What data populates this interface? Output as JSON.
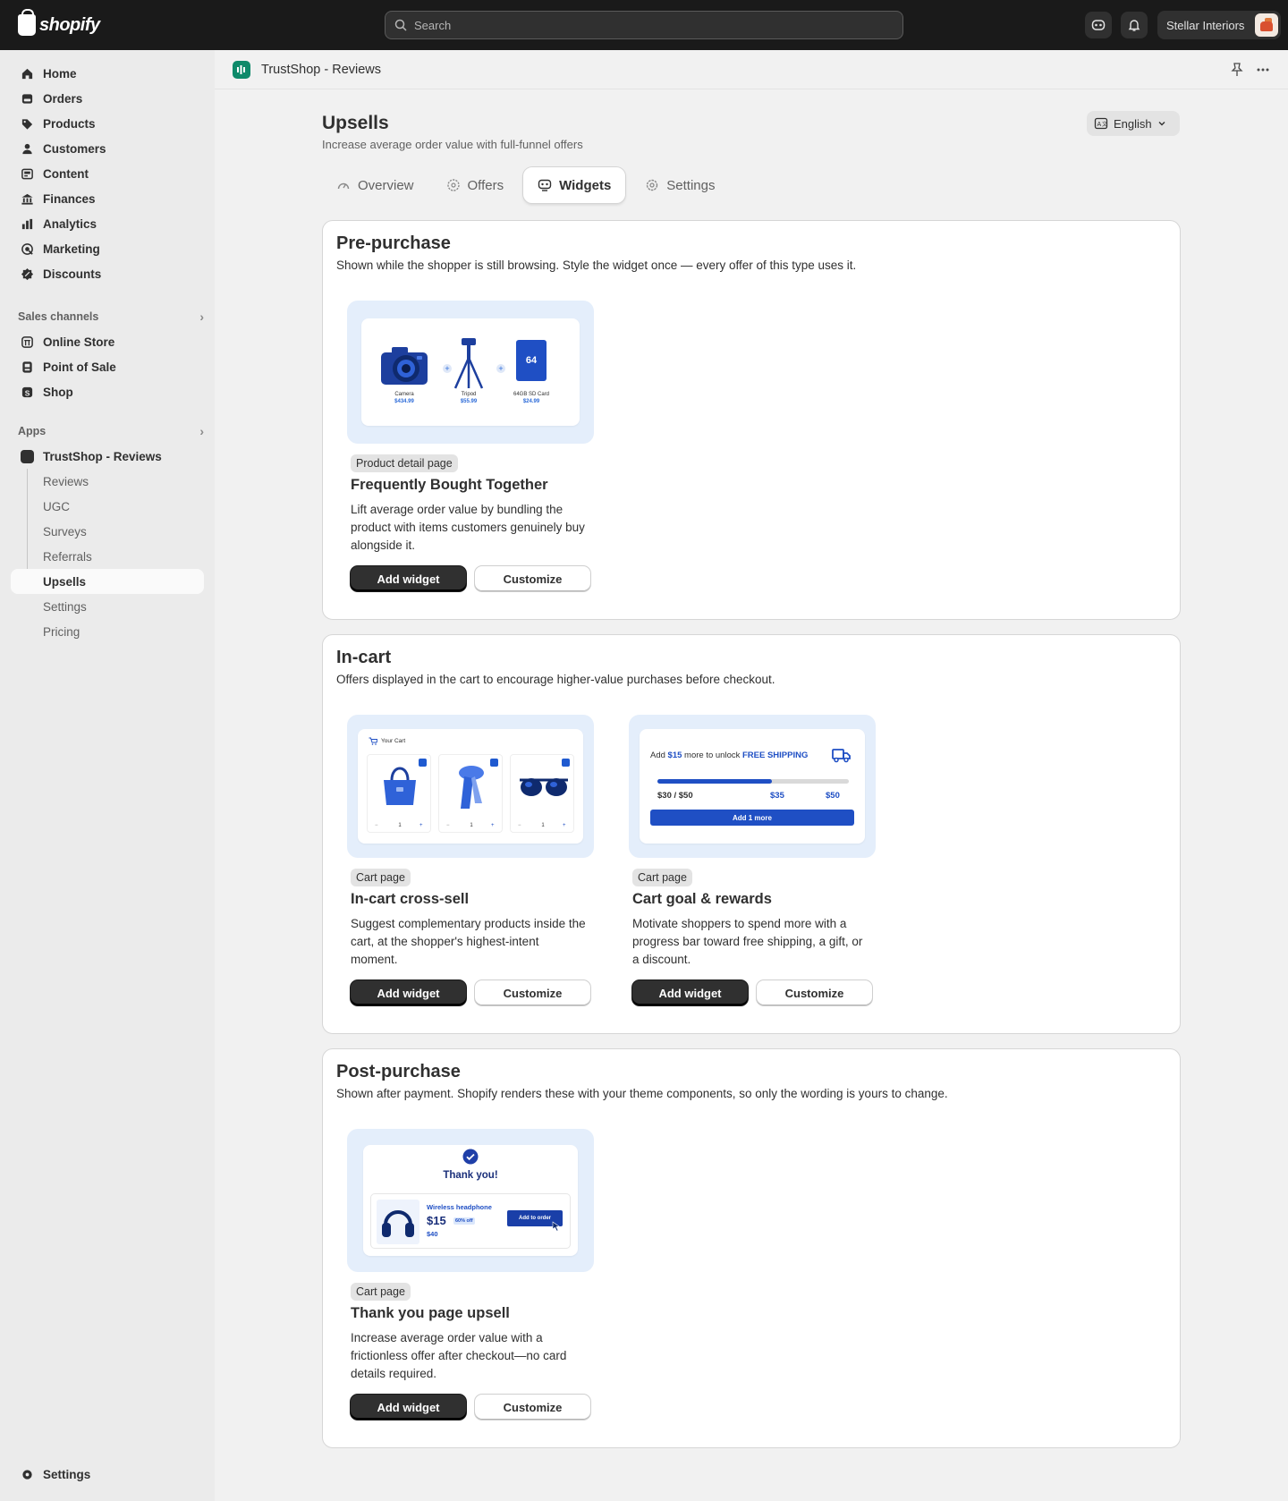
{
  "topbar": {
    "logo_text": "shopify",
    "search_placeholder": "Search",
    "store_name": "Stellar Interiors"
  },
  "sidebar": {
    "main_items": [
      {
        "label": "Home",
        "icon": "home-icon"
      },
      {
        "label": "Orders",
        "icon": "orders-icon"
      },
      {
        "label": "Products",
        "icon": "tag-icon"
      },
      {
        "label": "Customers",
        "icon": "person-icon"
      },
      {
        "label": "Content",
        "icon": "content-icon"
      },
      {
        "label": "Finances",
        "icon": "bank-icon"
      },
      {
        "label": "Analytics",
        "icon": "chart-icon"
      },
      {
        "label": "Marketing",
        "icon": "target-icon"
      },
      {
        "label": "Discounts",
        "icon": "discount-icon"
      }
    ],
    "sales_channels_label": "Sales channels",
    "sales_channels": [
      {
        "label": "Online Store",
        "icon": "store-icon"
      },
      {
        "label": "Point of Sale",
        "icon": "pos-icon"
      },
      {
        "label": "Shop",
        "icon": "shop-icon"
      }
    ],
    "apps_label": "Apps",
    "app_name": "TrustShop - Reviews",
    "app_sub_items": [
      "Reviews",
      "UGC",
      "Surveys",
      "Referrals",
      "Upsells",
      "Settings",
      "Pricing"
    ],
    "active_sub_item": "Upsells",
    "settings_label": "Settings"
  },
  "appbar": {
    "title": "TrustShop - Reviews"
  },
  "page": {
    "title": "Upsells",
    "subtitle": "Increase average order value with full-funnel offers",
    "language": "English",
    "tabs": [
      "Overview",
      "Offers",
      "Widgets",
      "Settings"
    ],
    "active_tab": "Widgets"
  },
  "sections": {
    "pre": {
      "title": "Pre-purchase",
      "description": "Shown while the shopper is still browsing. Style the widget once — every offer of this type uses it."
    },
    "incart": {
      "title": "In-cart",
      "description": "Offers displayed in the cart to encourage higher-value purchases before checkout."
    },
    "post": {
      "title": "Post-purchase",
      "description": "Shown after payment. Shopify renders these with your theme components, so only the wording is yours to change."
    }
  },
  "widgets": {
    "fbt": {
      "badge": "Product detail page",
      "title": "Frequently Bought Together",
      "description": "Lift average order value by bundling the product with items customers genuinely buy alongside it.",
      "preview": {
        "items": [
          {
            "name": "Camera",
            "price": "$434.99"
          },
          {
            "name": "Tripod",
            "price": "$55.99"
          },
          {
            "name": "64GB SD Card",
            "price": "$24.99"
          }
        ],
        "sd_label": "64"
      }
    },
    "crosssell": {
      "badge": "Cart page",
      "title": "In-cart cross-sell",
      "description": "Suggest complementary products inside the cart, at the shopper's highest-intent moment.",
      "preview": {
        "header": "Your Cart",
        "qty": [
          "1",
          "1",
          "1"
        ]
      }
    },
    "goal": {
      "badge": "Cart page",
      "title": "Cart goal & rewards",
      "description": "Motivate shoppers to spend more with a progress bar toward free shipping, a gift, or a discount.",
      "preview": {
        "msg_prefix": "Add",
        "msg_amount": "$15",
        "msg_middle": "more to unlock",
        "msg_reward": "FREE SHIPPING",
        "progress_label": "$30 / $50",
        "milestone_1": "$35",
        "milestone_2": "$50",
        "progress_fraction": 0.6,
        "button": "Add 1 more"
      }
    },
    "thankyou": {
      "badge": "Cart page",
      "title": "Thank you page upsell",
      "description": "Increase average order value with a frictionless offer after checkout—no card details required.",
      "preview": {
        "heading": "Thank you!",
        "product": "Wireless headphone",
        "price": "$15",
        "discount": "60% off",
        "old_price": "$40",
        "button": "Add to order"
      }
    }
  },
  "buttons": {
    "add_widget": "Add widget",
    "customize": "Customize"
  },
  "colors": {
    "topbar": "#1a1a1a",
    "accent_blue": "#1f4fc4",
    "preview_bg": "#e4eefb",
    "primary_button": "#303030"
  }
}
